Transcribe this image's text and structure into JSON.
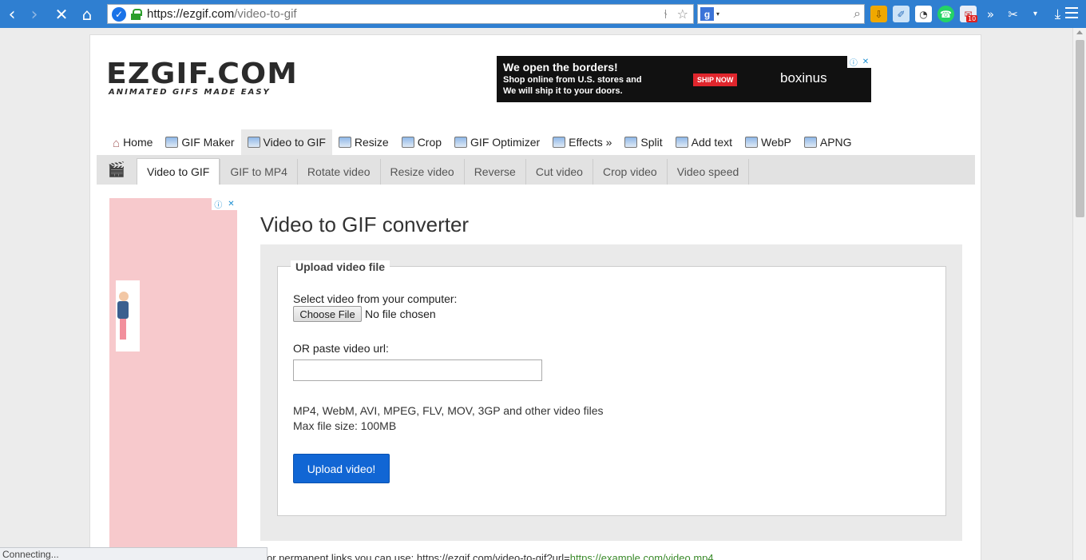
{
  "browser": {
    "url_host": "https://ezgif.com",
    "url_path": "/video-to-gif",
    "status_text": "Connecting...",
    "extension_badge": "10"
  },
  "logo": {
    "main": "EZGIF.COM",
    "tagline": "ANIMATED GIFS MADE EASY"
  },
  "ad_top": {
    "headline": "We open the borders!",
    "line1": "Shop online from U.S. stores and",
    "line2": "We will ship it to your doors.",
    "cta": "SHIP NOW",
    "brand": "boxinus"
  },
  "main_nav": [
    {
      "label": "Home",
      "icon": "home-icon"
    },
    {
      "label": "GIF Maker",
      "icon": "gif-maker-icon"
    },
    {
      "label": "Video to GIF",
      "icon": "film-icon",
      "active": true
    },
    {
      "label": "Resize",
      "icon": "resize-icon"
    },
    {
      "label": "Crop",
      "icon": "crop-icon"
    },
    {
      "label": "GIF Optimizer",
      "icon": "optimizer-icon"
    },
    {
      "label": "Effects »",
      "icon": "effects-icon"
    },
    {
      "label": "Split",
      "icon": "split-icon"
    },
    {
      "label": "Add text",
      "icon": "add-text-icon"
    },
    {
      "label": "WebP",
      "icon": "webp-icon"
    },
    {
      "label": "APNG",
      "icon": "apng-icon"
    }
  ],
  "sub_nav": [
    {
      "label": "Video to GIF",
      "active": true
    },
    {
      "label": "GIF to MP4"
    },
    {
      "label": "Rotate video"
    },
    {
      "label": "Resize video"
    },
    {
      "label": "Reverse"
    },
    {
      "label": "Cut video"
    },
    {
      "label": "Crop video"
    },
    {
      "label": "Video speed"
    }
  ],
  "page": {
    "title": "Video to GIF converter",
    "legend": "Upload video file",
    "select_label": "Select video from your computer:",
    "choose_file": "Choose File",
    "no_file": "No file chosen",
    "url_label": "OR paste video url:",
    "url_value": "",
    "formats": "MP4, WebM, AVI, MPEG, FLV, MOV, 3GP and other video files",
    "max_size": "Max file size: 100MB",
    "upload_button": "Upload video!",
    "permalink_prefix": "or permanent links you can use: https://ezgif.com/video-to-gif?url=",
    "permalink_example": "https://example.com/video.mp4"
  }
}
